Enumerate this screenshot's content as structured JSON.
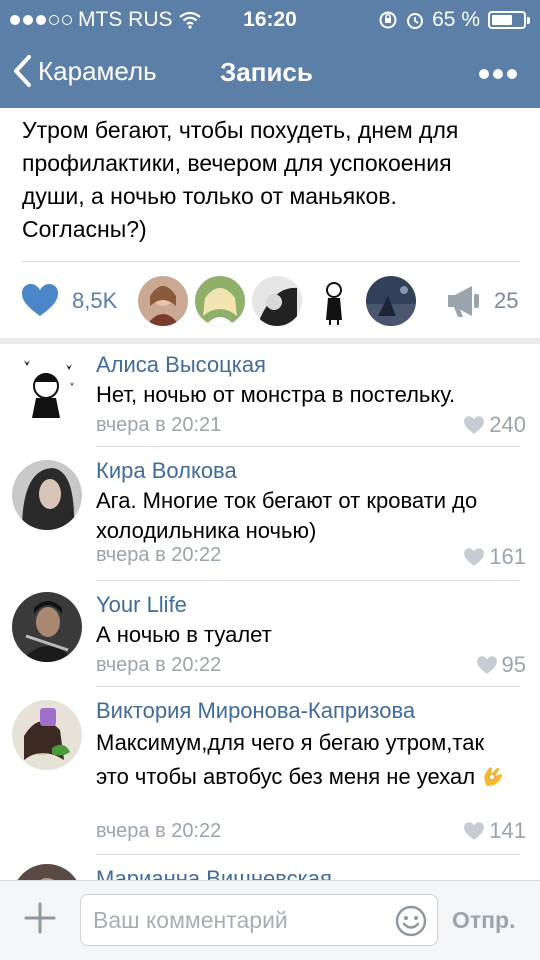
{
  "status_bar": {
    "carrier": "MTS RUS",
    "time": "16:20",
    "battery_percent": "65 %",
    "battery_level": 0.65
  },
  "nav": {
    "back_label": "Карамель",
    "title": "Запись",
    "more_icon": "ellipsis-icon"
  },
  "post": {
    "text": "Утром бегают, чтобы похудеть, днем для профилактики, вечером для успокоения души, а ночью только от маньяков. Согласны?)",
    "likes": "8,5K",
    "shares": "25"
  },
  "comments": [
    {
      "author": "Алиса Высоцкая",
      "text": "Нет, ночью от монстра в постельку.",
      "time": "вчера в 20:21",
      "likes": "240"
    },
    {
      "author": "Кира Волкова",
      "text": "Ага. Многие ток бегают от кровати до холодильника ночью)",
      "time": "вчера в 20:22",
      "likes": "161"
    },
    {
      "author": "Your Llife",
      "text": "А ночью в туалет",
      "time": "вчера в 20:22",
      "likes": "95"
    },
    {
      "author": "Виктория Миронова-Капризова",
      "text": "Максимум,для чего я бегаю утром,так это чтобы автобус без меня не уехал",
      "time": "вчера в 20:22",
      "likes": "141"
    },
    {
      "author": "Марианна Вишневская"
    }
  ],
  "composer": {
    "placeholder": "Ваш комментарий",
    "send_label": "Отпр."
  },
  "colors": {
    "header": "#5b7fa6",
    "link": "#3f6c9a",
    "like_heart": "#4a86c8"
  }
}
